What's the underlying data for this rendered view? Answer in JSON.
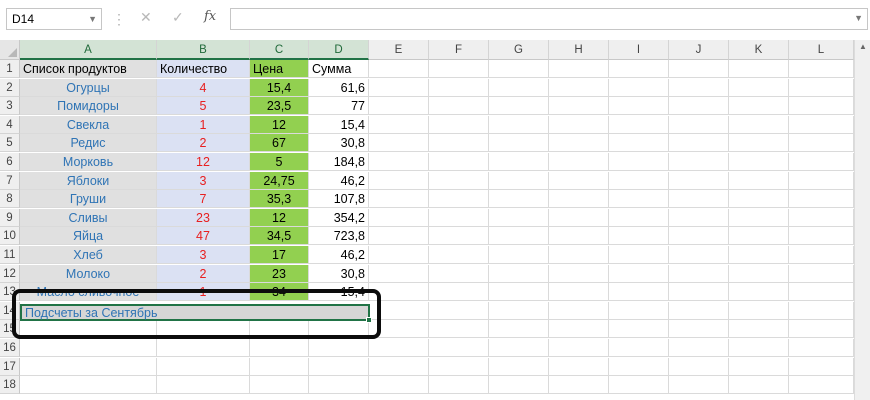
{
  "formula_bar": {
    "name_box": "D14",
    "fx_label": "fx",
    "formula_value": ""
  },
  "columns": [
    "A",
    "B",
    "C",
    "D",
    "E",
    "F",
    "G",
    "H",
    "I",
    "J",
    "K",
    "L"
  ],
  "row_numbers": [
    "1",
    "2",
    "3",
    "4",
    "5",
    "6",
    "7",
    "8",
    "9",
    "10",
    "11",
    "12",
    "13",
    "14",
    "15",
    "16",
    "17",
    "18"
  ],
  "headers": {
    "a": "Список продуктов",
    "b": "Количество",
    "c": "Цена",
    "d": "Сумма"
  },
  "rows": [
    {
      "a": "Огурцы",
      "b": "4",
      "c": "15,4",
      "d": "61,6"
    },
    {
      "a": "Помидоры",
      "b": "5",
      "c": "23,5",
      "d": "77"
    },
    {
      "a": "Свекла",
      "b": "1",
      "c": "12",
      "d": "15,4"
    },
    {
      "a": "Редис",
      "b": "2",
      "c": "67",
      "d": "30,8"
    },
    {
      "a": "Морковь",
      "b": "12",
      "c": "5",
      "d": "184,8"
    },
    {
      "a": "Яблоки",
      "b": "3",
      "c": "24,75",
      "d": "46,2"
    },
    {
      "a": "Груши",
      "b": "7",
      "c": "35,3",
      "d": "107,8"
    },
    {
      "a": "Сливы",
      "b": "23",
      "c": "12",
      "d": "354,2"
    },
    {
      "a": "Яйца",
      "b": "47",
      "c": "34,5",
      "d": "723,8"
    },
    {
      "a": "Хлеб",
      "b": "3",
      "c": "17",
      "d": "46,2"
    },
    {
      "a": "Молоко",
      "b": "2",
      "c": "23",
      "d": "30,8"
    },
    {
      "a": "Масло сливочное",
      "b": "1",
      "c": "34",
      "d": "15,4"
    }
  ],
  "merged_cell_text": "Подсчеты за Сентябрь",
  "colors": {
    "excel_green": "#217346",
    "col_a_fill": "#e0e0e0",
    "col_b_fill": "#dbe1f3",
    "col_c_fill": "#92d050",
    "product_text": "#2f74b5",
    "quantity_text": "#e81f1f"
  }
}
